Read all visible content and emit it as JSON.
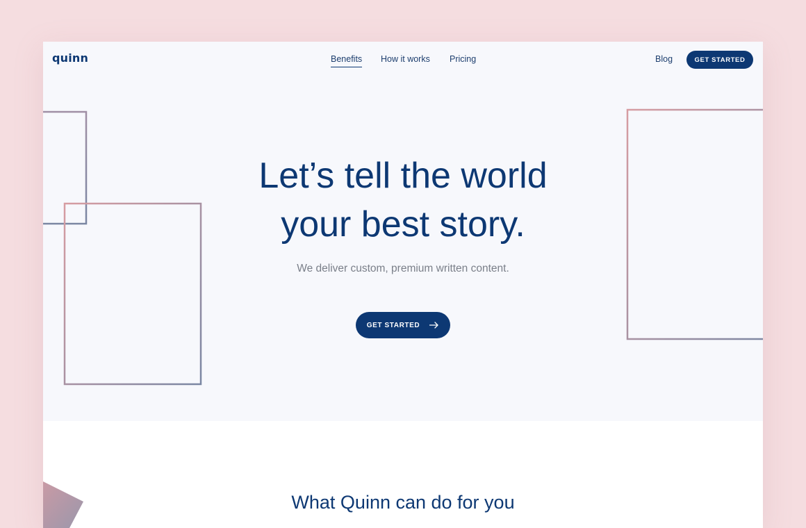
{
  "nav": {
    "logo": "quinn",
    "links": [
      {
        "label": "Benefits",
        "active": true
      },
      {
        "label": "How it works",
        "active": false
      },
      {
        "label": "Pricing",
        "active": false
      }
    ],
    "blog": "Blog",
    "cta": "GET STARTED"
  },
  "hero": {
    "headline_line1": "Let’s tell the world",
    "headline_line2": "your best story.",
    "subhead": "We deliver custom, premium written content.",
    "cta": "GET STARTED",
    "cta_icon": "arrow-right-icon"
  },
  "features": {
    "title": "What Quinn can do for you"
  },
  "colors": {
    "page_background": "#f5dde0",
    "hero_background": "#f7f8fc",
    "brand_navy": "#0d3873",
    "muted_text": "#7a7f89",
    "deco_pink": "#d79da2",
    "deco_slate": "#7a86a2"
  }
}
